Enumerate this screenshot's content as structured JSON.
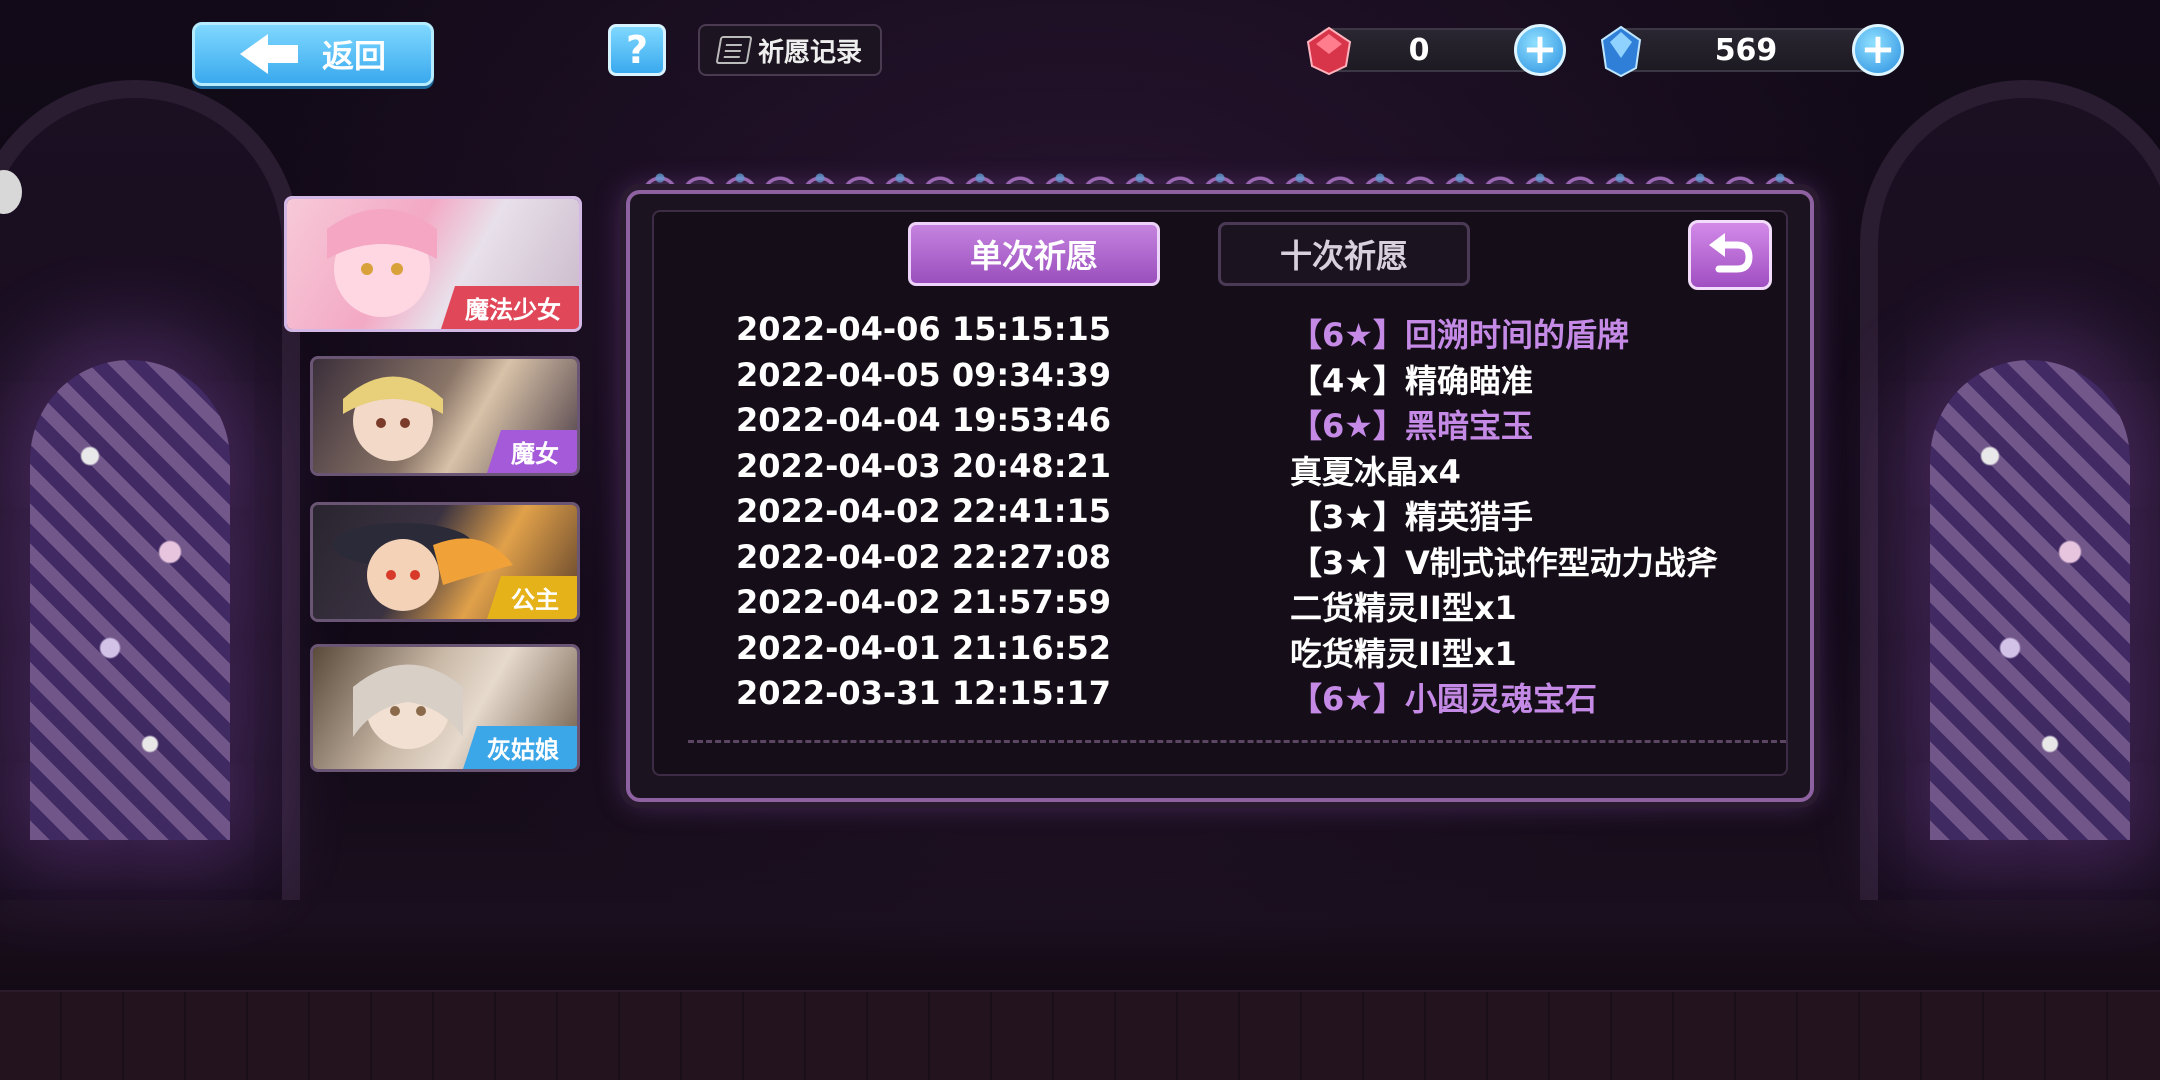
{
  "top_bar": {
    "back_label": "返回",
    "help_label": "?",
    "record_label": "祈愿记录",
    "currency_red": {
      "icon": "red-gem-icon",
      "value": "0"
    },
    "currency_blue": {
      "icon": "blue-crystal-icon",
      "value": "569"
    }
  },
  "characters": [
    {
      "label": "魔法少女",
      "label_color": "#e0485a",
      "active": true
    },
    {
      "label": "魔女",
      "label_color": "#a55ad9",
      "active": false
    },
    {
      "label": "公主",
      "label_color": "#e6b21a",
      "active": false
    },
    {
      "label": "灰姑娘",
      "label_color": "#3ca7e8",
      "active": false
    }
  ],
  "tabs": {
    "single": "单次祈愿",
    "ten": "十次祈愿"
  },
  "records": [
    {
      "time": "2022-04-06 15:15:15",
      "item": "【6★】回溯时间的盾牌",
      "rare": true
    },
    {
      "time": "2022-04-05 09:34:39",
      "item": "【4★】精确瞄准",
      "rare": false
    },
    {
      "time": "2022-04-04 19:53:46",
      "item": "【6★】黑暗宝玉",
      "rare": true
    },
    {
      "time": "2022-04-03 20:48:21",
      "item": "真夏冰晶x4",
      "rare": false
    },
    {
      "time": "2022-04-02 22:41:15",
      "item": "【3★】精英猎手",
      "rare": false
    },
    {
      "time": "2022-04-02 22:27:08",
      "item": "【3★】V制式试作型动力战斧",
      "rare": false
    },
    {
      "time": "2022-04-02 21:57:59",
      "item": "二货精灵II型x1",
      "rare": false
    },
    {
      "time": "2022-04-01 21:16:52",
      "item": "吃货精灵II型x1",
      "rare": false
    },
    {
      "time": "2022-03-31 12:15:17",
      "item": "【6★】小圆灵魂宝石",
      "rare": true
    }
  ],
  "colors": {
    "accent_purple": "#b46ad6",
    "rare_item": "#c48ae6",
    "button_blue": "#3aa9ee"
  }
}
